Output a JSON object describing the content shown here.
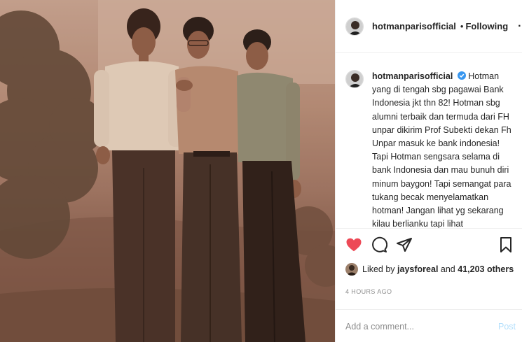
{
  "post": {
    "username": "hotmanparisofficial",
    "separator": "•",
    "follow_status": "Following",
    "more_label": "···"
  },
  "caption": {
    "username": "hotmanparisofficial",
    "text": "Hotman yang di tengah sbg pagawai Bank Indonesia jkt thn 82! Hotman sbg alumni terbaik dan termuda dari FH unpar dikirim Prof Subekti dekan Fh Unpar masuk ke bank indonesia! Tapi Hotman sengsara selama di bank Indonesia dan mau bunuh diri minum baygon! Tapi semangat para tukang becak menyelamatkan hotman! Jangan lihat yg sekarang kilau berlianku tapi lihat"
  },
  "actions": {
    "like_icon": "heart-icon",
    "comment_icon": "comment-icon",
    "share_icon": "share-icon",
    "save_icon": "bookmark-icon",
    "like_color": "#ed4956"
  },
  "likes": {
    "prefix": "Liked by ",
    "user": "jaysforeal",
    "middle": " and ",
    "count": "41,203 others"
  },
  "timestamp": "4 HOURS AGO",
  "add_comment": {
    "placeholder": "Add a comment...",
    "post_label": "Post"
  },
  "colors": {
    "verified": "#3897f0",
    "post_disabled": "#b2dffc",
    "muted": "#8e8e8e"
  }
}
